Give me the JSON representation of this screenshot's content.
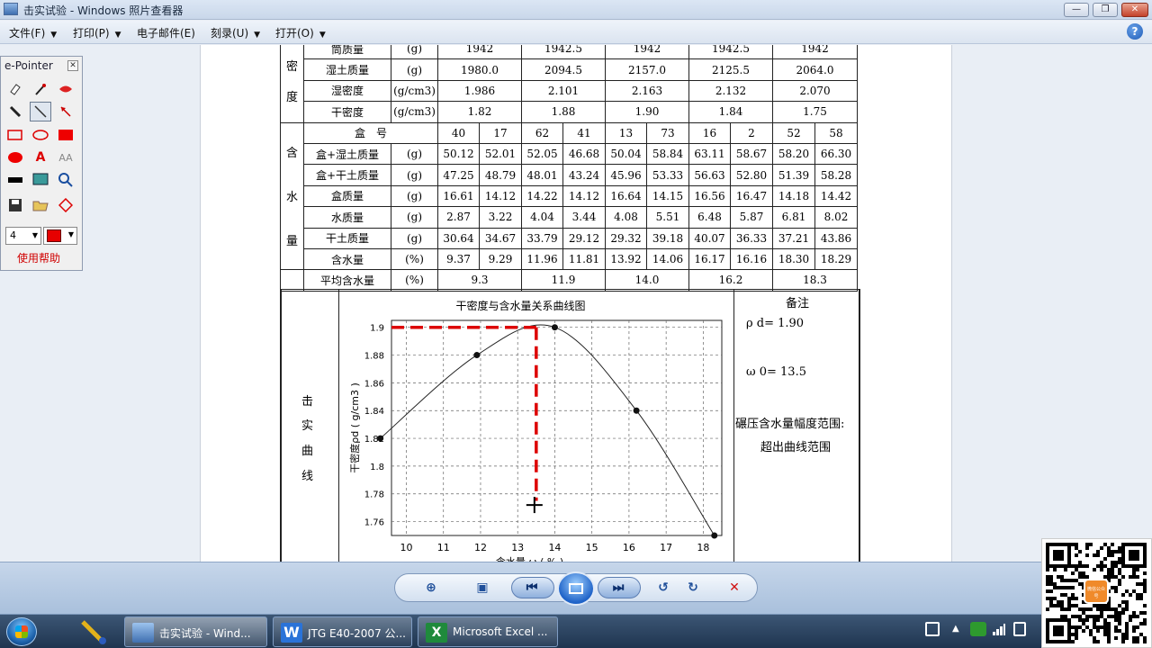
{
  "window": {
    "title": "击实试验 - Windows 照片查看器"
  },
  "menu": {
    "items": [
      {
        "label": "文件(F)",
        "caret": true
      },
      {
        "label": "打印(P)",
        "caret": true
      },
      {
        "label": "电子邮件(E)",
        "caret": false
      },
      {
        "label": "刻录(U)",
        "caret": true
      },
      {
        "label": "打开(O)",
        "caret": true
      }
    ],
    "help": "?"
  },
  "epointer": {
    "title": "e-Pointer",
    "pen_size": "4",
    "color": "#e60000",
    "help_label": "使用帮助",
    "tools": [
      "eraser-icon",
      "pen-icon",
      "highlighter-icon",
      "marker-icon",
      "line-icon",
      "arrow-icon",
      "rectangle-icon",
      "ellipse-icon",
      "filled-rectangle-icon",
      "filled-ellipse-icon",
      "text-icon",
      "font-icon",
      "black-bar-icon",
      "screen-icon",
      "zoom-icon",
      "save-icon",
      "open-icon",
      "erase-all-icon"
    ]
  },
  "document": {
    "density_label": [
      "密",
      "度"
    ],
    "moisture_label": [
      "含",
      "水",
      "量"
    ],
    "partial_row": {
      "name": "筒质量",
      "unit": "(g)",
      "values": [
        "1942",
        "1942.5",
        "1942",
        "1942.5",
        "1942"
      ]
    },
    "density_rows": [
      {
        "name": "湿土质量",
        "unit": "(g)",
        "values": [
          "1980.0",
          "2094.5",
          "2157.0",
          "2125.5",
          "2064.0"
        ]
      },
      {
        "name": "湿密度",
        "unit": "(g/cm3)",
        "values": [
          "1.986",
          "2.101",
          "2.163",
          "2.132",
          "2.070"
        ]
      },
      {
        "name": "干密度",
        "unit": "(g/cm3)",
        "values": [
          "1.82",
          "1.88",
          "1.90",
          "1.84",
          "1.75"
        ]
      }
    ],
    "box_row": {
      "name": "盒　号",
      "values": [
        "40",
        "17",
        "62",
        "41",
        "13",
        "73",
        "16",
        "2",
        "52",
        "58"
      ]
    },
    "moisture_rows": [
      {
        "name": "盒+湿土质量",
        "unit": "(g)",
        "values": [
          "50.12",
          "52.01",
          "52.05",
          "46.68",
          "50.04",
          "58.84",
          "63.11",
          "58.67",
          "58.20",
          "66.30"
        ]
      },
      {
        "name": "盒+干土质量",
        "unit": "(g)",
        "values": [
          "47.25",
          "48.79",
          "48.01",
          "43.24",
          "45.96",
          "53.33",
          "56.63",
          "52.80",
          "51.39",
          "58.28"
        ]
      },
      {
        "name": "盒质量",
        "unit": "(g)",
        "values": [
          "16.61",
          "14.12",
          "14.22",
          "14.12",
          "16.64",
          "14.15",
          "16.56",
          "16.47",
          "14.18",
          "14.42"
        ]
      },
      {
        "name": "水质量",
        "unit": "(g)",
        "values": [
          "2.87",
          "3.22",
          "4.04",
          "3.44",
          "4.08",
          "5.51",
          "6.48",
          "5.87",
          "6.81",
          "8.02"
        ]
      },
      {
        "name": "干土质量",
        "unit": "(g)",
        "values": [
          "30.64",
          "34.67",
          "33.79",
          "29.12",
          "29.32",
          "39.18",
          "40.07",
          "36.33",
          "37.21",
          "43.86"
        ]
      },
      {
        "name": "含水量",
        "unit": "(%)",
        "values": [
          "9.37",
          "9.29",
          "11.96",
          "11.81",
          "13.92",
          "14.06",
          "16.17",
          "16.16",
          "18.30",
          "18.29"
        ]
      }
    ],
    "avg_row": {
      "name": "平均含水量",
      "unit": "(%)",
      "values": [
        "9.3",
        "11.9",
        "14.0",
        "16.2",
        "18.3"
      ]
    },
    "curve_label": [
      "击",
      "实",
      "曲",
      "线"
    ],
    "notes": {
      "title": "备注",
      "rho": "ρ d=  1.90",
      "omega": "ω 0=  13.5",
      "range_label": "碾压含水量幅度范围:",
      "range_value": "超出曲线范围"
    }
  },
  "chart_data": {
    "type": "line",
    "title": "干密度与含水量关系曲线图",
    "ylabel": "干密度ρd ( g/cm3 )",
    "xlabel": "含水量 ω ( % )",
    "x": [
      9.3,
      11.9,
      14.0,
      16.2,
      18.3
    ],
    "y": [
      1.82,
      1.88,
      1.9,
      1.84,
      1.75
    ],
    "xlim": [
      9.6,
      18.5
    ],
    "ylim": [
      1.75,
      1.905
    ],
    "xticks": [
      10,
      11,
      12,
      13,
      14,
      15,
      16,
      17,
      18
    ],
    "yticks": [
      1.76,
      1.78,
      1.8,
      1.82,
      1.84,
      1.86,
      1.88,
      1.9
    ],
    "grid": true,
    "annotation": {
      "type": "red-dashed-guide",
      "x": 13.5,
      "y": 1.9,
      "color": "#dd0000"
    }
  },
  "controls": {
    "buttons": [
      "zoom-icon",
      "fit-icon",
      "previous-icon",
      "slideshow-icon",
      "next-icon",
      "rotate-left-icon",
      "rotate-right-icon",
      "delete-icon"
    ]
  },
  "taskbar": {
    "tasks": [
      {
        "label": "击实试验 - Wind...",
        "active": true,
        "color": "#5a8fd0"
      },
      {
        "label": "JTG E40-2007 公...",
        "active": false,
        "color": "#2a73d8"
      },
      {
        "label": "Microsoft Excel ...",
        "active": false,
        "color": "#1f8a3c"
      }
    ]
  },
  "qr": {
    "badge": "微信公众号"
  }
}
